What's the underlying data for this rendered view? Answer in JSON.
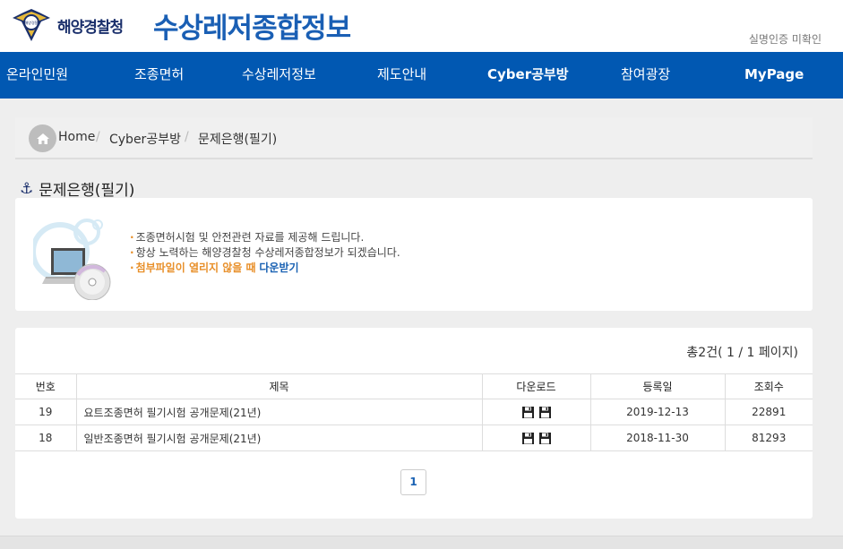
{
  "header": {
    "org_name": "해양경찰청",
    "emblem_text": "해양경찰",
    "site_title": "수상레저종합정보",
    "auth_status": "실명인증 미확인"
  },
  "nav": {
    "items": [
      {
        "label": "온라인민원"
      },
      {
        "label": "조종면허"
      },
      {
        "label": "수상레저정보"
      },
      {
        "label": "제도안내"
      },
      {
        "label": "Cyber공부방"
      },
      {
        "label": "참여광장"
      },
      {
        "label": "MyPage"
      }
    ]
  },
  "breadcrumb": {
    "home_icon": "home-icon",
    "items": [
      "Home",
      "Cyber공부방",
      "문제은행(필기)"
    ],
    "separator": "/"
  },
  "page": {
    "heading_icon": "anchor-icon",
    "heading": "문제은행(필기)"
  },
  "info": {
    "line1": "조종면허시험 및 안전관련 자료를 제공해 드립니다.",
    "line2": "항상 노력하는 해양경찰청 수상레저종합정보가 되겠습니다.",
    "line3_warn": "첨부파일이 열리지 않을 때",
    "line3_link": "다운받기",
    "bullet": "·",
    "accent_color": "#e8902b",
    "link_color": "#1a62b3"
  },
  "list": {
    "total": "총2건( 1 / 1 페이지)",
    "columns": [
      "번호",
      "제목",
      "다운로드",
      "등록일",
      "조회수"
    ],
    "rows": [
      {
        "no": "19",
        "title": "요트조종면허 필기시험 공개문제(21년)",
        "date": "2019-12-13",
        "views": "22891"
      },
      {
        "no": "18",
        "title": "일반조종면허 필기시험 공개문제(21년)",
        "date": "2018-11-30",
        "views": "81293"
      }
    ],
    "download_icon": "floppy-disk-icon"
  },
  "pagination": {
    "current": "1"
  },
  "colors": {
    "nav_bg": "#0158b2",
    "title_blue": "#1a5fb4"
  }
}
